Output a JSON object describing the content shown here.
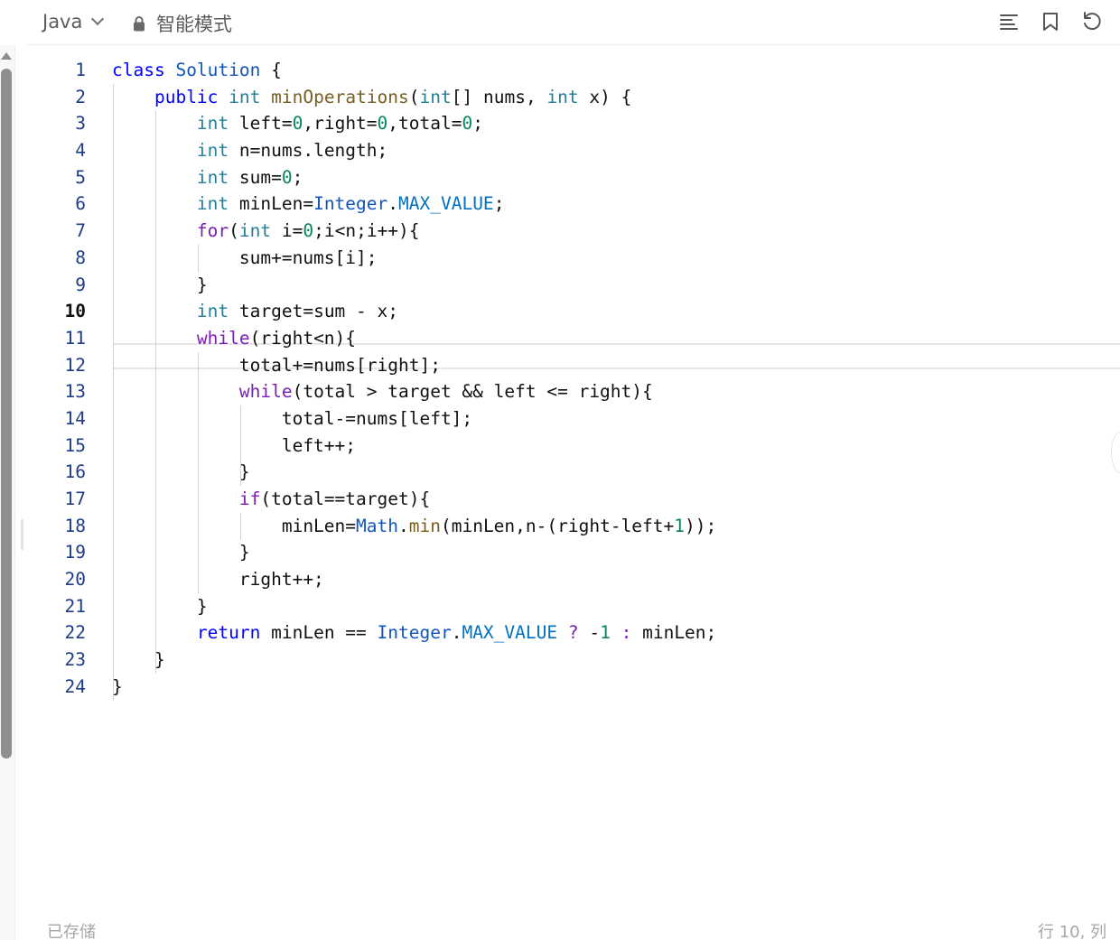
{
  "toolbar": {
    "language": "Java",
    "mode_label": "智能模式",
    "icons": [
      "outline-icon",
      "bookmark-icon",
      "reset-icon"
    ]
  },
  "editor": {
    "active_line": 10,
    "lines": [
      {
        "n": "1",
        "code": "class Solution {"
      },
      {
        "n": "2",
        "code": "    public int minOperations(int[] nums, int x) {"
      },
      {
        "n": "3",
        "code": "        int left=0,right=0,total=0;"
      },
      {
        "n": "4",
        "code": "        int n=nums.length;"
      },
      {
        "n": "5",
        "code": "        int sum=0;"
      },
      {
        "n": "6",
        "code": "        int minLen=Integer.MAX_VALUE;"
      },
      {
        "n": "7",
        "code": "        for(int i=0;i<n;i++){"
      },
      {
        "n": "8",
        "code": "            sum+=nums[i];"
      },
      {
        "n": "9",
        "code": "        }"
      },
      {
        "n": "10",
        "code": "        int target=sum - x;"
      },
      {
        "n": "11",
        "code": "        while(right<n){"
      },
      {
        "n": "12",
        "code": "            total+=nums[right];"
      },
      {
        "n": "13",
        "code": "            while(total > target && left <= right){"
      },
      {
        "n": "14",
        "code": "                total-=nums[left];"
      },
      {
        "n": "15",
        "code": "                left++;"
      },
      {
        "n": "16",
        "code": "            }"
      },
      {
        "n": "17",
        "code": "            if(total==target){"
      },
      {
        "n": "18",
        "code": "                minLen=Math.min(minLen,n-(right-left+1));"
      },
      {
        "n": "19",
        "code": "            }"
      },
      {
        "n": "20",
        "code": "            right++;"
      },
      {
        "n": "21",
        "code": "        }"
      },
      {
        "n": "22",
        "code": "        return minLen == Integer.MAX_VALUE ? -1 : minLen;"
      },
      {
        "n": "23",
        "code": "    }"
      },
      {
        "n": "24",
        "code": "}"
      }
    ]
  },
  "status": {
    "saved": "已存储",
    "position": "行 10, 列"
  },
  "colors": {
    "keyword": "#0000ff",
    "control": "#7a1fb2",
    "type": "#267f99",
    "number": "#098658",
    "line_number": "#1e3b8a"
  }
}
